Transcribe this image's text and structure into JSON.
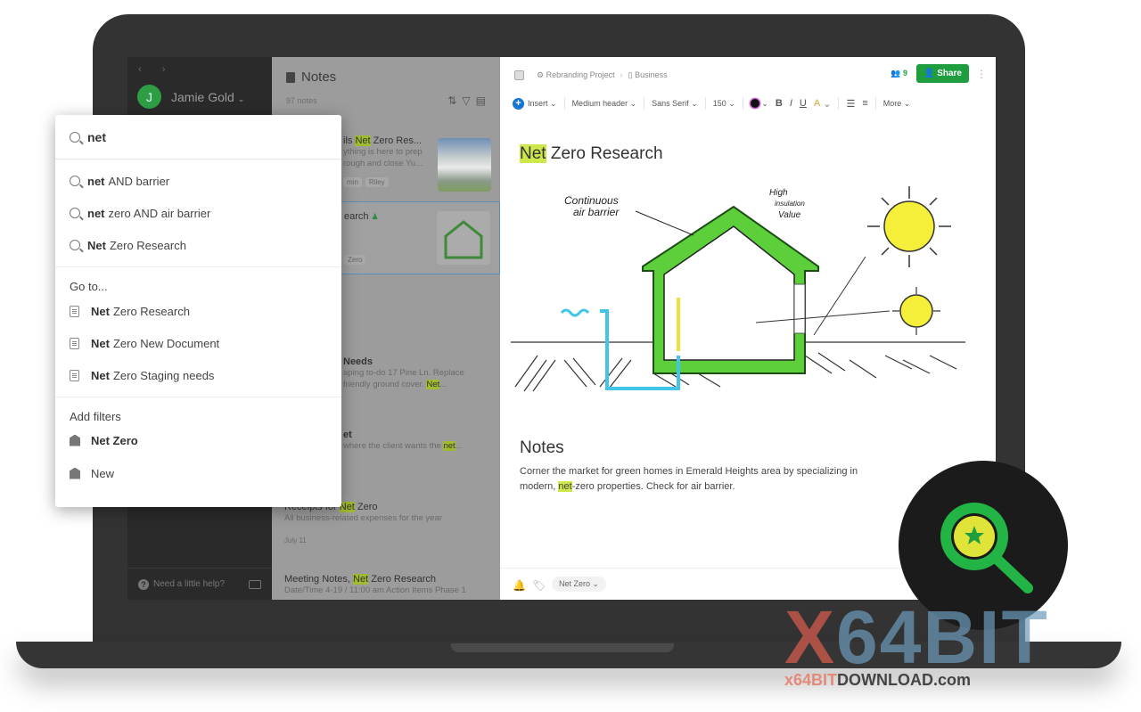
{
  "sidebar": {
    "nav_arrows": "‹ ›",
    "user_initial": "J",
    "user_name": "Jamie Gold",
    "help_text": "Need a little help?"
  },
  "notelist": {
    "title": "Notes",
    "count": "97 notes",
    "notes": [
      {
        "title_pre": "ils ",
        "title_hl": "Net",
        "title_post": " Zero Res...",
        "snippet": "ything is here to prep rough and close Yu...",
        "tags": [
          "min",
          "Riley"
        ]
      },
      {
        "title_pre": "earch",
        "title_hl": "",
        "title_post": "",
        "snippet": "",
        "tags": [
          "Zero"
        ]
      },
      {
        "title_pre": "Needs",
        "title_hl": "",
        "title_post": "",
        "snippet_pre": "aping to-do 17 Pine Ln. Replace friendly ground cover. ",
        "snippet_hl": "Net",
        "snippet_post": "..."
      },
      {
        "title_pre": "et",
        "snippet_pre": "where the client wants the ",
        "snippet_hl": "net",
        "snippet_post": "..."
      },
      {
        "title_pre": "Receipts for ",
        "title_hl": "Net",
        "title_post": " Zero",
        "snippet": "All business-related expenses for the year",
        "date": "July 11"
      },
      {
        "title_pre": "Meeting Notes, ",
        "title_hl": "Net",
        "title_post": " Zero Research",
        "snippet": "Date/Time 4-19 / 11:00 am Action Items Phase 1"
      }
    ]
  },
  "editor": {
    "breadcrumb": [
      "Rebranding Project",
      "Business"
    ],
    "member_count": "9",
    "share_label": "Share",
    "toolbar": {
      "insert": "Insert",
      "style": "Medium header",
      "font": "Sans Serif",
      "size": "150",
      "bold": "B",
      "italic": "I",
      "underline": "U",
      "highlight": "A",
      "more": "More"
    },
    "title_hl": "Net",
    "title_rest": " Zero Research",
    "sketch_labels": {
      "air": "Continuous air barrier",
      "insulation": "High insulation Value"
    },
    "notes_heading": "Notes",
    "notes_body_pre": "Corner the market for green homes in Emerald Heights area by specializing in modern, ",
    "notes_body_hl": "net",
    "notes_body_post": "-zero properties. Check for air barrier.",
    "footer_tag": "Net Zero"
  },
  "search": {
    "query": "net",
    "suggestions": [
      {
        "bold": "net",
        "rest": "AND barrier"
      },
      {
        "bold": "net",
        "rest": "zero AND air barrier"
      },
      {
        "bold": "Net",
        "rest": "Zero Research"
      }
    ],
    "goto_label": "Go to...",
    "goto": [
      {
        "bold": "Net",
        "rest": "Zero Research"
      },
      {
        "bold": "Net",
        "rest": "Zero New Document"
      },
      {
        "bold": "Net",
        "rest": "Zero Staging needs"
      }
    ],
    "filters_label": "Add filters",
    "filters": [
      {
        "label": "Net Zero",
        "bold": true
      },
      {
        "label": "New",
        "bold": false
      }
    ]
  },
  "watermark": {
    "big_x": "X",
    "big_rest": "64BIT",
    "small_pre": "x64BIT",
    "small_rest": "DOWNLOAD.com"
  },
  "colors": {
    "accent_green": "#1f9e3f",
    "highlight": "#cde84a",
    "insert_blue": "#1676d2"
  }
}
